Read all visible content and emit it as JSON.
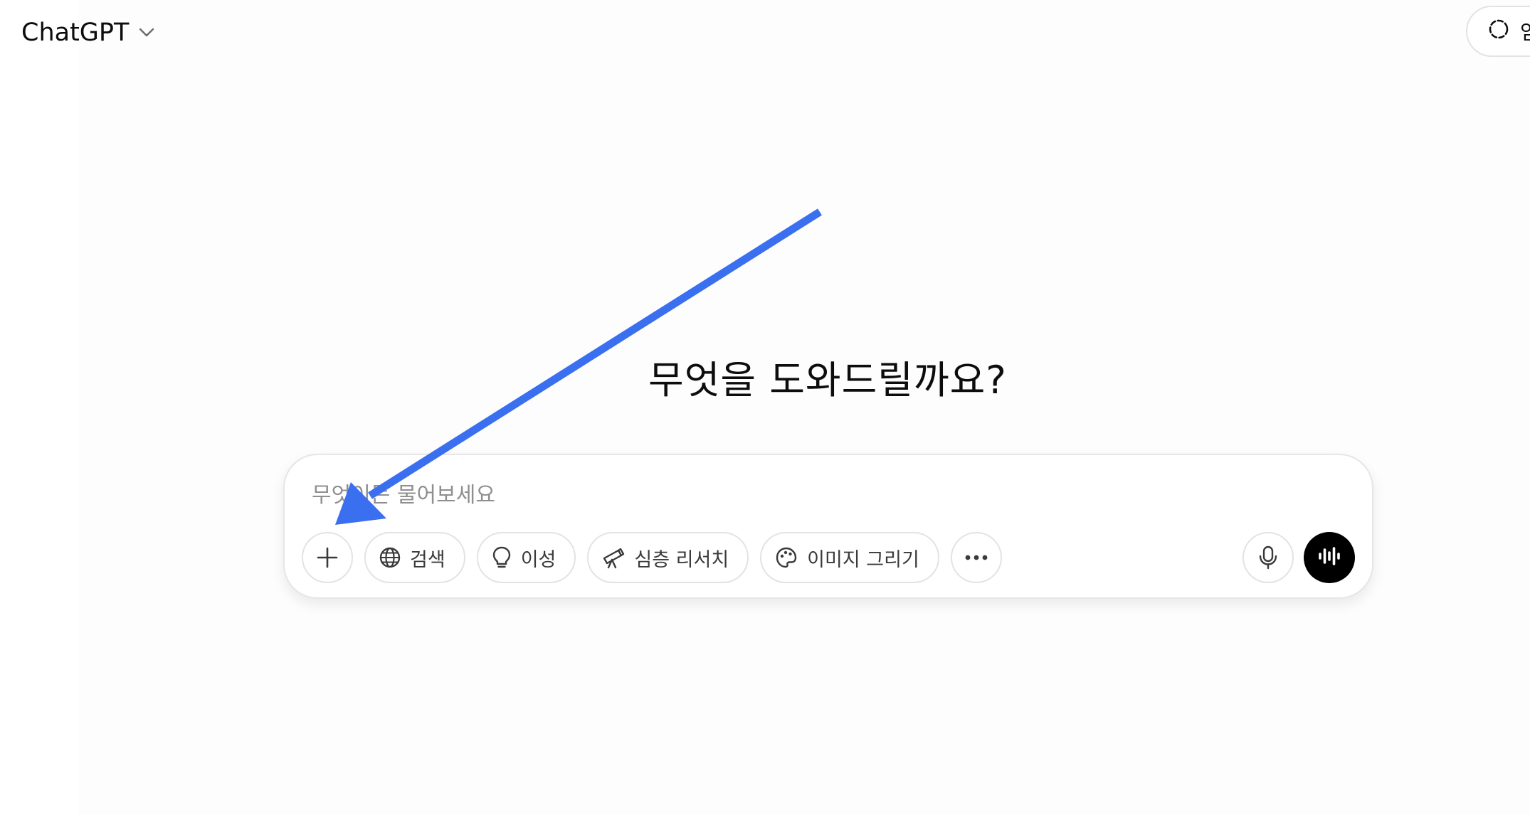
{
  "header": {
    "model_name": "ChatGPT",
    "temp_chat_label": "임시"
  },
  "main": {
    "greeting": "무엇을 도와드릴까요?"
  },
  "composer": {
    "placeholder": "무엇이든 물어보세요",
    "tools": {
      "search_label": "검색",
      "reason_label": "이성",
      "deep_research_label": "심층 리서치",
      "image_label": "이미지 그리기"
    }
  },
  "icons": {
    "chevron": "chevron-down-icon",
    "temp_chat": "dashed-circle-icon",
    "add": "plus-icon",
    "search": "globe-icon",
    "reason": "lightbulb-icon",
    "deep_research": "telescope-icon",
    "image": "palette-icon",
    "more": "ellipsis-icon",
    "mic": "microphone-icon",
    "voice": "voice-waveform-icon"
  },
  "colors": {
    "annotation_arrow": "#3a6ff0",
    "voice_button": "#000000",
    "text_primary": "#0d0d0d",
    "placeholder": "#8f8f8f"
  }
}
